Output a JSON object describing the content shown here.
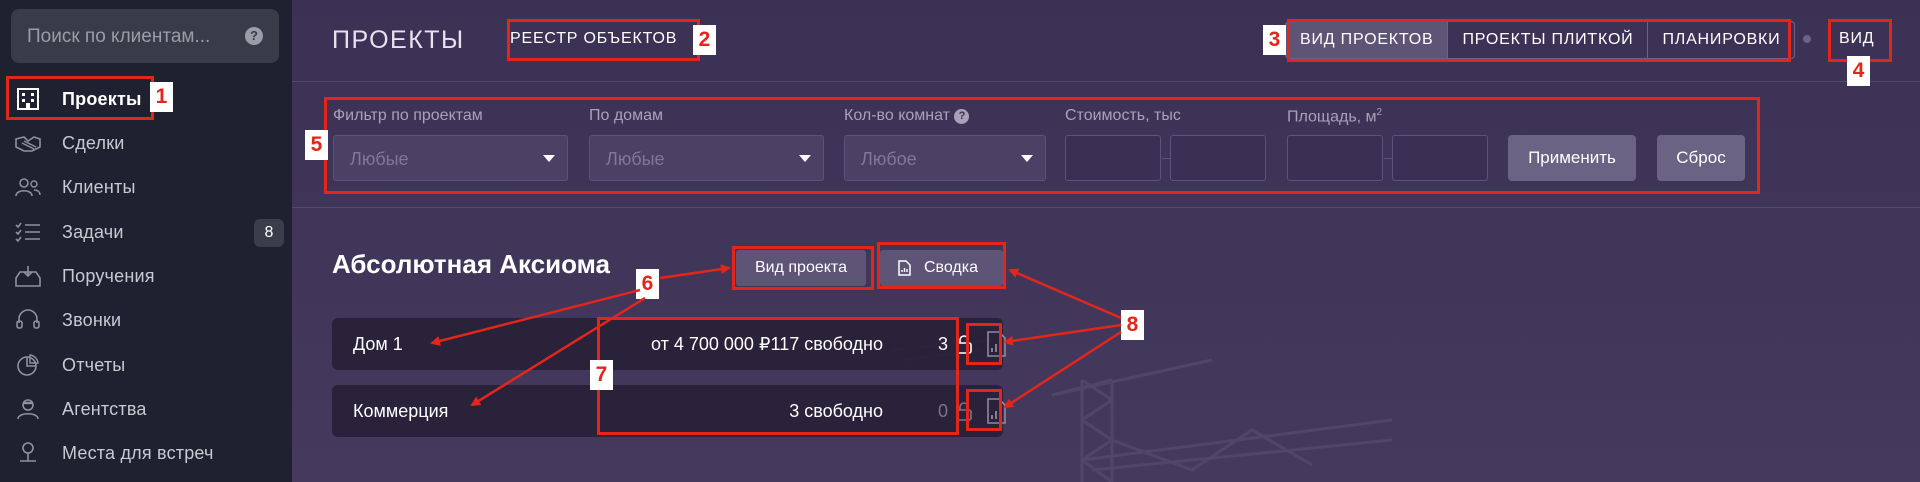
{
  "sidebar": {
    "search_placeholder": "Поиск по клиентам...",
    "help_glyph": "?",
    "items": [
      {
        "label": "Проекты",
        "icon": "building-icon",
        "active": true
      },
      {
        "label": "Сделки",
        "icon": "handshake-icon"
      },
      {
        "label": "Клиенты",
        "icon": "users-icon"
      },
      {
        "label": "Задачи",
        "icon": "checklist-icon",
        "badge": "8"
      },
      {
        "label": "Поручения",
        "icon": "tray-icon"
      },
      {
        "label": "Звонки",
        "icon": "headset-icon"
      },
      {
        "label": "Отчеты",
        "icon": "pie-chart-icon"
      },
      {
        "label": "Агентства",
        "icon": "agent-icon"
      },
      {
        "label": "Места для встреч",
        "icon": "map-pin-icon"
      }
    ]
  },
  "header": {
    "title": "ПРОЕКТЫ",
    "registry_button": "РЕЕСТР ОБЪЕКТОВ",
    "view_tabs": [
      "ВИД ПРОЕКТОВ",
      "ПРОЕКТЫ ПЛИТКОЙ",
      "ПЛАНИРОВКИ"
    ],
    "view_button": "ВИД"
  },
  "filters": {
    "project_label": "Фильтр по проектам",
    "project_value": "Любые",
    "houses_label": "По домам",
    "houses_value": "Любые",
    "rooms_label": "Кол-во комнат",
    "rooms_value": "Любое",
    "price_label": "Стоимость, тыс",
    "area_label": "Площадь, м",
    "area_sup": "2",
    "apply_button": "Применить",
    "reset_button": "Сброс"
  },
  "project": {
    "name": "Абсолютная Аксиома",
    "view_button": "Вид проекта",
    "summary_button": "Сводка",
    "houses": [
      {
        "name": "Дом 1",
        "price": "от 4 700 000 ₽",
        "free": "117 свободно",
        "locked": "3"
      },
      {
        "name": "Коммерция",
        "price": "",
        "free": "3 свободно",
        "locked": "0"
      }
    ]
  },
  "annotations": [
    "1",
    "2",
    "3",
    "4",
    "5",
    "6",
    "7",
    "8"
  ],
  "colors": {
    "annotation": "#e3261b",
    "sidebar_bg": "#1f2130",
    "main_bg": "#3a3054"
  }
}
